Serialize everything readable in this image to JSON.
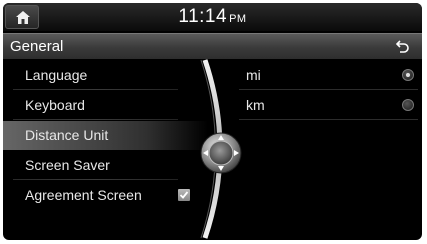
{
  "status": {
    "time": "11:14",
    "ampm": "PM",
    "home_icon": "home-icon"
  },
  "header": {
    "title": "General",
    "back_icon": "back-arrow-icon"
  },
  "menu": {
    "items": [
      {
        "label": "Language",
        "selected": false
      },
      {
        "label": "Keyboard",
        "selected": false
      },
      {
        "label": "Distance Unit",
        "selected": true
      },
      {
        "label": "Screen Saver",
        "selected": false
      },
      {
        "label": "Agreement Screen",
        "selected": false,
        "checked": true
      }
    ]
  },
  "options": [
    {
      "label": "mi",
      "selected": true
    },
    {
      "label": "km",
      "selected": false
    }
  ],
  "joystick": {
    "icon": "joystick-knob-icon"
  }
}
